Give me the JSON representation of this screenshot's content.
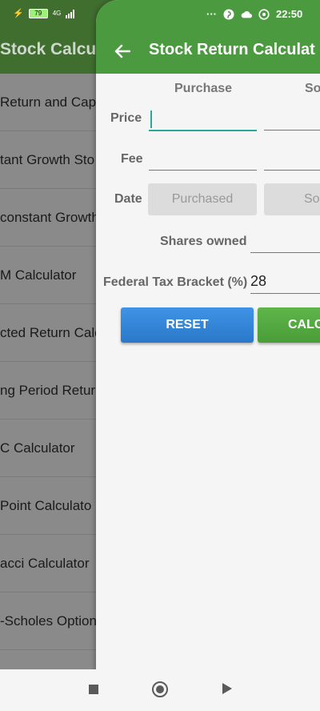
{
  "status": {
    "battery": "79",
    "network": "4G",
    "dots": "···",
    "time": "22:50"
  },
  "background": {
    "title": "Stock Calcul",
    "items": [
      "Return and Cap",
      "tant Growth Sto",
      "constant Growth",
      "M Calculator",
      "cted Return Calc",
      "ng Period Retur",
      "C Calculator",
      "Point Calculato",
      "acci Calculator",
      "-Scholes Option"
    ]
  },
  "appbar": {
    "title": "Stock Return Calculat"
  },
  "form": {
    "col_purchase": "Purchase",
    "col_sold": "So",
    "price_label": "Price",
    "fee_label": "Fee",
    "date_label": "Date",
    "date_purchased_btn": "Purchased",
    "date_sold_btn": "So",
    "shares_label": "Shares owned",
    "tax_label": "Federal Tax Bracket (%)",
    "tax_value": "28",
    "reset_label": "RESET",
    "calc_label": "CALC"
  },
  "colors": {
    "appbar": "#4c9a3f",
    "accent": "#2aa89a",
    "reset": "#2a78c9",
    "calc": "#4a9c38"
  }
}
